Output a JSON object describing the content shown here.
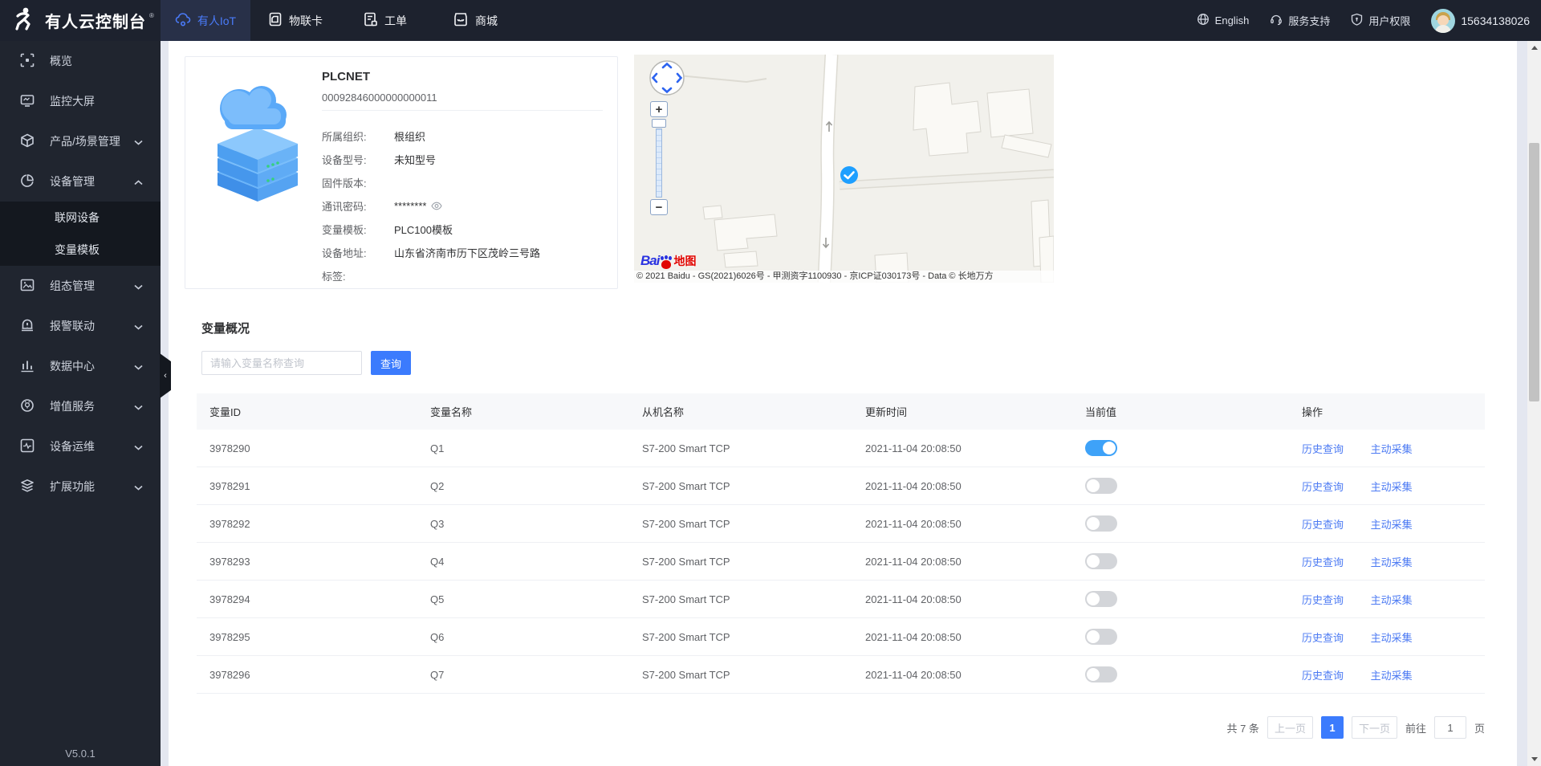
{
  "topbar": {
    "logo_title": "有人云控制台",
    "reg": "®",
    "tabs": [
      {
        "label": "有人IoT",
        "active": true
      },
      {
        "label": "物联卡",
        "active": false
      },
      {
        "label": "工单",
        "active": false
      },
      {
        "label": "商城",
        "active": false
      }
    ],
    "right": {
      "language": "English",
      "support": "服务支持",
      "permission": "用户权限",
      "phone": "15634138026"
    }
  },
  "sidebar": {
    "items": [
      {
        "label": "概览"
      },
      {
        "label": "监控大屏"
      },
      {
        "label": "产品/场景管理"
      },
      {
        "label": "设备管理"
      },
      {
        "label": "联网设备"
      },
      {
        "label": "变量模板"
      },
      {
        "label": "组态管理"
      },
      {
        "label": "报警联动"
      },
      {
        "label": "数据中心"
      },
      {
        "label": "增值服务"
      },
      {
        "label": "设备运维"
      },
      {
        "label": "扩展功能"
      }
    ],
    "version": "V5.0.1"
  },
  "device": {
    "name": "PLCNET",
    "id": "00092846000000000011",
    "fields": [
      {
        "label": "所属组织:",
        "value": "根组织"
      },
      {
        "label": "设备型号:",
        "value": "未知型号"
      },
      {
        "label": "固件版本:",
        "value": ""
      },
      {
        "label": "通讯密码:",
        "value": "********",
        "eye": true
      },
      {
        "label": "变量模板:",
        "value": "PLC100模板"
      },
      {
        "label": "设备地址:",
        "value": "山东省济南市历下区茂岭三号路"
      },
      {
        "label": "标签:",
        "value": ""
      }
    ]
  },
  "map": {
    "logo_bai": "Bai",
    "logo_badge": "地图",
    "zoom_in": "+",
    "zoom_out": "−",
    "attribution": "© 2021 Baidu - GS(2021)6026号 - 甲测资字1100930 - 京ICP证030173号 - Data © 长地万方"
  },
  "variables": {
    "section_title": "变量概况",
    "search_placeholder": "请输入变量名称查询",
    "search_button": "查询",
    "table": {
      "headers": [
        "变量ID",
        "变量名称",
        "从机名称",
        "更新时间",
        "当前值",
        "操作"
      ],
      "rows": [
        {
          "id": "3978290",
          "name": "Q1",
          "slave": "S7-200 Smart TCP",
          "updated": "2021-11-04 20:08:50",
          "on": true,
          "actions": [
            "历史查询",
            "主动采集"
          ]
        },
        {
          "id": "3978291",
          "name": "Q2",
          "slave": "S7-200 Smart TCP",
          "updated": "2021-11-04 20:08:50",
          "on": false,
          "actions": [
            "历史查询",
            "主动采集"
          ]
        },
        {
          "id": "3978292",
          "name": "Q3",
          "slave": "S7-200 Smart TCP",
          "updated": "2021-11-04 20:08:50",
          "on": false,
          "actions": [
            "历史查询",
            "主动采集"
          ]
        },
        {
          "id": "3978293",
          "name": "Q4",
          "slave": "S7-200 Smart TCP",
          "updated": "2021-11-04 20:08:50",
          "on": false,
          "actions": [
            "历史查询",
            "主动采集"
          ]
        },
        {
          "id": "3978294",
          "name": "Q5",
          "slave": "S7-200 Smart TCP",
          "updated": "2021-11-04 20:08:50",
          "on": false,
          "actions": [
            "历史查询",
            "主动采集"
          ]
        },
        {
          "id": "3978295",
          "name": "Q6",
          "slave": "S7-200 Smart TCP",
          "updated": "2021-11-04 20:08:50",
          "on": false,
          "actions": [
            "历史查询",
            "主动采集"
          ]
        },
        {
          "id": "3978296",
          "name": "Q7",
          "slave": "S7-200 Smart TCP",
          "updated": "2021-11-04 20:08:50",
          "on": false,
          "actions": [
            "历史查询",
            "主动采集"
          ]
        }
      ]
    },
    "pagination": {
      "total": "共 7 条",
      "prev": "上一页",
      "page": "1",
      "next": "下一页",
      "goto_prefix": "前往",
      "goto_value": "1",
      "goto_suffix": "页"
    }
  },
  "colors": {
    "accent": "#3b7bfd",
    "toggle_on": "#3ea2f8",
    "link": "#4d7bf3",
    "topbar": "#1d222e",
    "sidebar": "#20252f"
  }
}
